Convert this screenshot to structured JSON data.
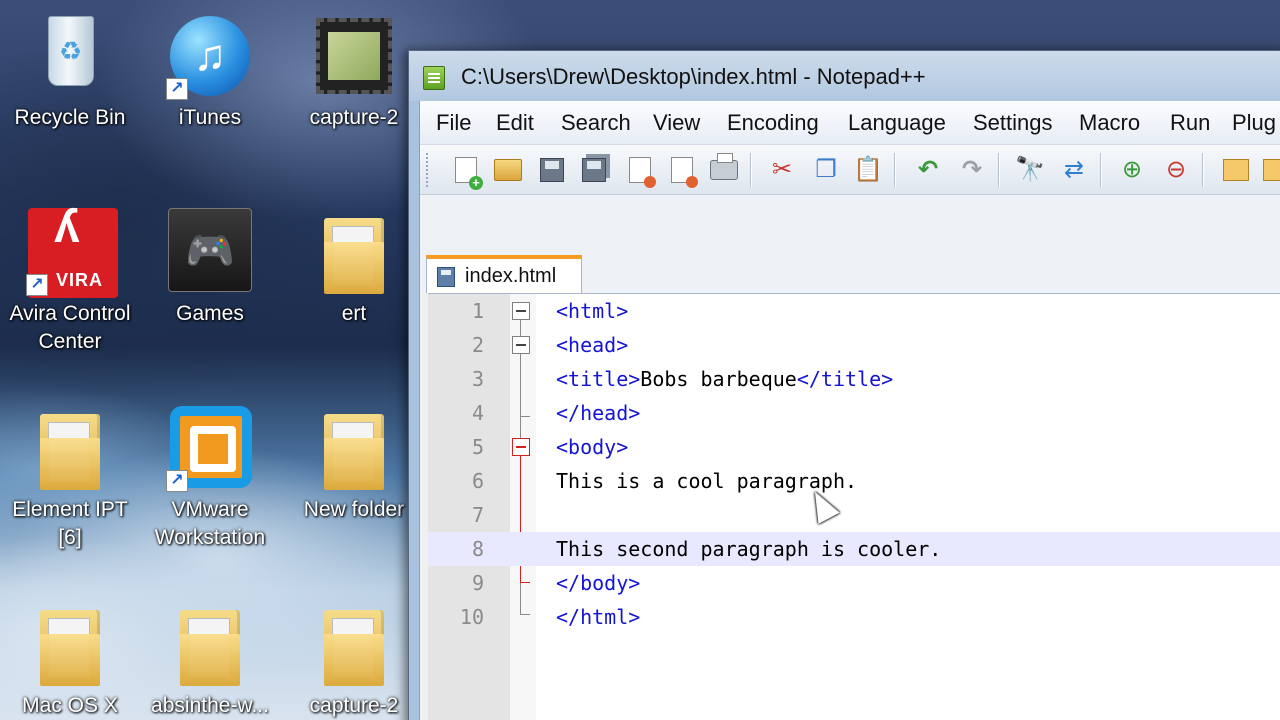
{
  "desktop": {
    "icons": [
      {
        "label": "Recycle Bin",
        "icon": "recycle-bin-icon"
      },
      {
        "label": "iTunes",
        "icon": "itunes-icon"
      },
      {
        "label": "capture-2",
        "icon": "video-file-icon"
      },
      {
        "label": "Avira Control Center",
        "label_line1": "Avira Control",
        "label_line2": "Center",
        "icon": "avira-icon",
        "logo_text": "VIRA"
      },
      {
        "label": "Games",
        "icon": "gamepad-icon"
      },
      {
        "label": "ert",
        "icon": "folder-icon"
      },
      {
        "label": "Element IPT [6]",
        "label_line1": "Element IPT",
        "label_line2": "[6]",
        "icon": "folder-icon"
      },
      {
        "label": "VMware Workstation",
        "label_line1": "VMware",
        "label_line2": "Workstation",
        "icon": "vmware-icon"
      },
      {
        "label": "New folder",
        "icon": "folder-icon"
      },
      {
        "label": "Mac OS X",
        "icon": "folder-icon"
      },
      {
        "label": "absinthe-w...",
        "icon": "folder-icon"
      },
      {
        "label": "capture-2",
        "icon": "folder-icon"
      }
    ]
  },
  "window": {
    "title": "C:\\Users\\Drew\\Desktop\\index.html - Notepad++",
    "menu": [
      "File",
      "Edit",
      "Search",
      "View",
      "Encoding",
      "Language",
      "Settings",
      "Macro",
      "Run",
      "Plug"
    ],
    "toolbar_icons": [
      "new-file-icon",
      "open-folder-icon",
      "save-icon",
      "save-all-icon",
      "close-icon",
      "close-all-icon",
      "print-icon",
      "cut-icon",
      "copy-icon",
      "paste-icon",
      "undo-icon",
      "redo-icon",
      "find-icon",
      "replace-icon",
      "zoom-in-icon",
      "zoom-out-icon",
      "sync-view-icon",
      "wrap-icon"
    ],
    "tab": {
      "label": "index.html"
    },
    "editor": {
      "lines": [
        {
          "num": "1",
          "parts": [
            {
              "t": "<html>",
              "tag": true
            }
          ]
        },
        {
          "num": "2",
          "parts": [
            {
              "t": "<head>",
              "tag": true
            }
          ]
        },
        {
          "num": "3",
          "parts": [
            {
              "t": "<title>",
              "tag": true
            },
            {
              "t": "Bobs barbeque",
              "tag": false
            },
            {
              "t": "</title>",
              "tag": true
            }
          ]
        },
        {
          "num": "4",
          "parts": [
            {
              "t": "</head>",
              "tag": true
            }
          ]
        },
        {
          "num": "5",
          "parts": [
            {
              "t": "<body>",
              "tag": true
            }
          ]
        },
        {
          "num": "6",
          "parts": [
            {
              "t": "This is a cool paragraph.",
              "tag": false
            }
          ]
        },
        {
          "num": "7",
          "parts": []
        },
        {
          "num": "8",
          "parts": [
            {
              "t": "This second paragraph is cooler.",
              "tag": false
            }
          ],
          "current": true
        },
        {
          "num": "9",
          "parts": [
            {
              "t": "</body>",
              "tag": true
            }
          ]
        },
        {
          "num": "10",
          "parts": [
            {
              "t": "</html>",
              "tag": true
            }
          ]
        }
      ]
    }
  }
}
